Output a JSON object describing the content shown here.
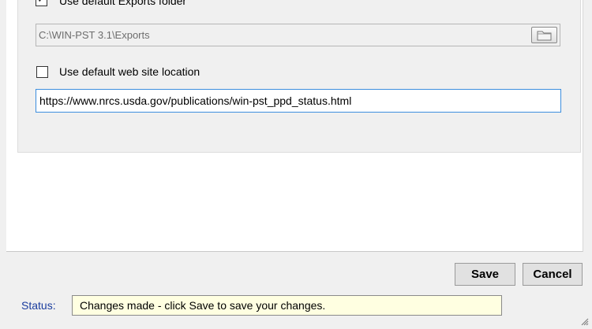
{
  "exports": {
    "checkbox_label": "Use default Exports folder",
    "checked": true,
    "path_value": "C:\\WIN-PST 3.1\\Exports"
  },
  "website": {
    "checkbox_label": "Use default web site location",
    "checked": false,
    "url_value": "https://www.nrcs.usda.gov/publications/win-pst_ppd_status.html"
  },
  "buttons": {
    "save_label": "Save",
    "cancel_label": "Cancel"
  },
  "status": {
    "label": "Status:",
    "message": "Changes made - click Save to save your changes."
  },
  "icons": {
    "browse": "folder-icon",
    "check": "checkmark-icon",
    "resize": "size-grip-icon"
  }
}
